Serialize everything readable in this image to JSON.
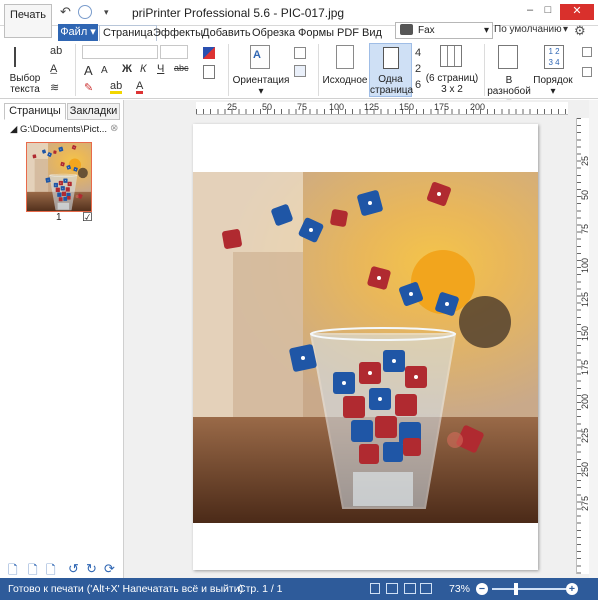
{
  "titlebar": {
    "print_label": "Печать",
    "title": "priPrinter Professional 5.6 - PIC-017.jpg",
    "minimize": "–",
    "maximize": "□",
    "close": "✕"
  },
  "tabs": {
    "file": "Файл",
    "items": [
      "Страница",
      "Эффекты",
      "Добавить",
      "Обрезка",
      "Формы",
      "PDF",
      "Вид"
    ],
    "active": "Страница"
  },
  "printer": {
    "name": "Fax",
    "profile": "По умолчанию"
  },
  "ribbon": {
    "select_text_label": "Выбор текста",
    "orientation_label": "Ориентация",
    "original_label": "Исходное",
    "one_page_label": "Одна страница",
    "pages_4": "4",
    "pages_2": "2",
    "pages_6": "6",
    "six_pages_label": "(6 страниц) 3 x 2",
    "scattered_label": "В разнобой",
    "order_label": "Порядок",
    "font_a_big": "A",
    "font_a_small": "A",
    "bold": "Ж",
    "italic": "К",
    "underline": "Ч",
    "strike": "abc"
  },
  "left_panel": {
    "tab_pages": "Страницы",
    "tab_bookmarks": "Закладки",
    "path": "G:\\Documents\\Pict...",
    "thumb_number": "1",
    "checkbox": "☑"
  },
  "ruler": {
    "h_ticks": [
      "25",
      "50",
      "75",
      "100",
      "125",
      "150",
      "175",
      "200"
    ],
    "v_ticks": [
      "25",
      "50",
      "75",
      "100",
      "125",
      "150",
      "175",
      "200",
      "225",
      "250",
      "275"
    ]
  },
  "status": {
    "left": "Готово к печати ('Alt+X' Напечатать всё и выйти)",
    "page": "Стр. 1 / 1",
    "zoom": "73%"
  },
  "colors": {
    "accent": "#2e5b9a",
    "file_tab": "#2f66b3",
    "close": "#d9302c"
  }
}
